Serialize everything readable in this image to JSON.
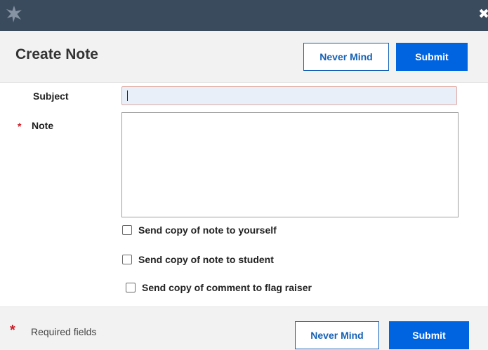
{
  "dialog": {
    "title": "Create Note",
    "close_symbol": "✖",
    "logo_icon": "starfish-logo-icon"
  },
  "header": {
    "never_mind_label": "Never Mind",
    "submit_label": "Submit"
  },
  "form": {
    "subject_label": "Subject",
    "subject_value": "",
    "note_label": "Note",
    "note_value": "",
    "required_marker": "*",
    "checkboxes": [
      {
        "label": "Send copy of note to yourself",
        "checked": false
      },
      {
        "label": "Send copy of note to student",
        "checked": false
      },
      {
        "label": "Send copy of comment to flag raiser",
        "checked": false
      }
    ]
  },
  "footer": {
    "required_marker": "*",
    "required_text": "Required fields",
    "never_mind_label": "Never Mind",
    "submit_label": "Submit"
  },
  "colors": {
    "titlebar": "#3b4b5e",
    "primary": "#0064e1",
    "secondary_border": "#1561b6",
    "required": "#c8202a"
  }
}
